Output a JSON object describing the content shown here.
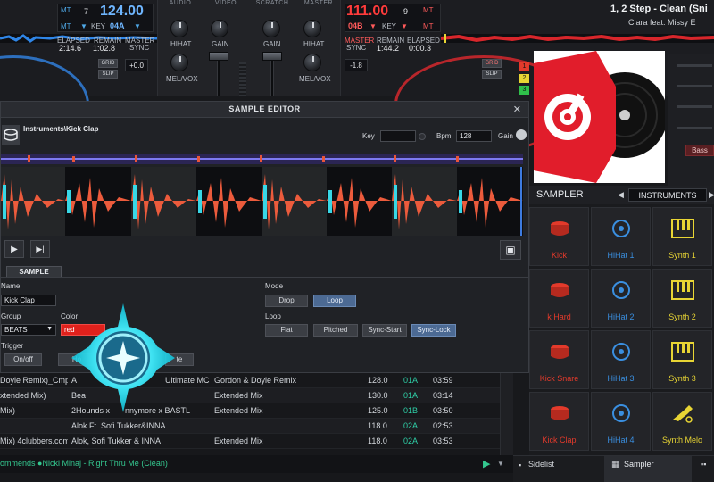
{
  "deck_left": {
    "bpm": "124.00",
    "key": "04A",
    "elapsed": "2:14.6",
    "remain": "1:02.8",
    "master_sync": "SYNC",
    "labels": {
      "elapsed": "ELAPSED",
      "remain": "REMAIN",
      "master": "MASTER",
      "key_label": "KEY",
      "mt": "MT"
    },
    "deck_no": "7",
    "slip": "SLIP",
    "grid": "GRID",
    "pitch": "+0.0"
  },
  "deck_right": {
    "bpm": "111.00",
    "key": "04B",
    "deck_no": "9",
    "elapsed": "0:00.3",
    "remain": "1:44.2",
    "master": "MASTER",
    "labels": {
      "elapsed": "ELAPSED",
      "remain": "REMAIN",
      "sync": "SYNC",
      "key_label": "KEY",
      "mt": "MT"
    },
    "title": "1, 2 Step - Clean (Sni",
    "artist": "Ciara feat. Missy E",
    "pitch": "-1.8",
    "slip": "SLIP",
    "grid": "GRID",
    "hotcues": [
      "1",
      "2",
      "3"
    ],
    "bass": "Bass"
  },
  "mixer": {
    "sections": [
      "AUDIO",
      "VIDEO",
      "SCRATCH",
      "MASTER"
    ],
    "knob_labels": [
      "HIHAT",
      "GAIN",
      "GAIN",
      "HIHAT",
      "MEL/VOX",
      "MEL/VOX"
    ]
  },
  "editor": {
    "title": "SAMPLE EDITOR",
    "path": "Instruments\\Kick Clap",
    "key_label": "Key",
    "key_value": "",
    "bpm_label": "Bpm",
    "bpm_value": "128",
    "gain_label": "Gain",
    "tab": "SAMPLE",
    "name_label": "Name",
    "name_value": "Kick Clap",
    "group_label": "Group",
    "group_value": "BEATS",
    "color_label": "Color",
    "color_value": "red",
    "trigger_label": "Trigger",
    "trigger_buttons": [
      "On/off",
      "Ho",
      "te"
    ],
    "mode_label": "Mode",
    "mode_buttons": [
      "Drop",
      "Loop"
    ],
    "loop_label": "Loop",
    "loop_buttons": [
      "Flat",
      "Pitched",
      "Sync-Start",
      "Sync-Lock"
    ],
    "colors": {
      "accent": "#4c6a93",
      "wave_a": "#f05a3a",
      "wave_b": "#33d6e6"
    }
  },
  "browser": {
    "rows": [
      {
        "title": "Doyle Remix)_Cmp3.eu",
        "artist": "A",
        "artist2": "Ultimate MC",
        "remix": "Gordon & Doyle Remix",
        "bpm": "128.0",
        "key": "01A",
        "length": "03:59"
      },
      {
        "title": "xtended Mix)",
        "artist": "Bea",
        "artist2": "",
        "remix": "Extended Mix",
        "bpm": "130.0",
        "key": "01A",
        "length": "03:14"
      },
      {
        "title": "Mix)",
        "artist": "2Hounds x",
        "artist2": "nnymore x BASTL",
        "remix": "Extended Mix",
        "bpm": "125.0",
        "key": "01B",
        "length": "03:50"
      },
      {
        "title": "",
        "artist": "Alok Ft. Sofi Tukker&INNA",
        "artist2": "",
        "remix": "",
        "bpm": "118.0",
        "key": "02A",
        "length": "02:53"
      },
      {
        "title": "Mix) 4clubbers.com.pl",
        "artist": "Alok, Sofi Tukker & INNA",
        "artist2": "",
        "remix": "Extended Mix",
        "bpm": "118.0",
        "key": "02A",
        "length": "03:53"
      }
    ],
    "ticker": "ommends  ●Nicki Minaj - Right Thru Me (Clean)"
  },
  "sampler": {
    "title": "SAMPLER",
    "bank": "INSTRUMENTS",
    "pads": [
      {
        "label": "Kick",
        "icon": "drum-icon",
        "color": "#e33a2b"
      },
      {
        "label": "HiHat 1",
        "icon": "cymbal-icon",
        "color": "#3a8fe0"
      },
      {
        "label": "Synth 1",
        "icon": "keyboard-icon",
        "color": "#e8d534"
      },
      {
        "label": "k Hard",
        "icon": "drum-icon",
        "color": "#e33a2b"
      },
      {
        "label": "HiHat 2",
        "icon": "cymbal-icon",
        "color": "#3a8fe0"
      },
      {
        "label": "Synth 2",
        "icon": "keyboard-icon",
        "color": "#e8d534"
      },
      {
        "label": "Kick Snare",
        "icon": "drum-icon",
        "color": "#e33a2b"
      },
      {
        "label": "HiHat 3",
        "icon": "cymbal-icon",
        "color": "#3a8fe0"
      },
      {
        "label": "Synth 3",
        "icon": "keyboard-icon",
        "color": "#e8d534"
      },
      {
        "label": "Kick Clap",
        "icon": "drum-icon",
        "color": "#e33a2b"
      },
      {
        "label": "HiHat 4",
        "icon": "cymbal-icon",
        "color": "#3a8fe0"
      },
      {
        "label": "Synth Melo",
        "icon": "trumpet-icon",
        "color": "#e8d534"
      }
    ],
    "bottom_tabs": [
      "Sidelist",
      "Sampler"
    ]
  }
}
